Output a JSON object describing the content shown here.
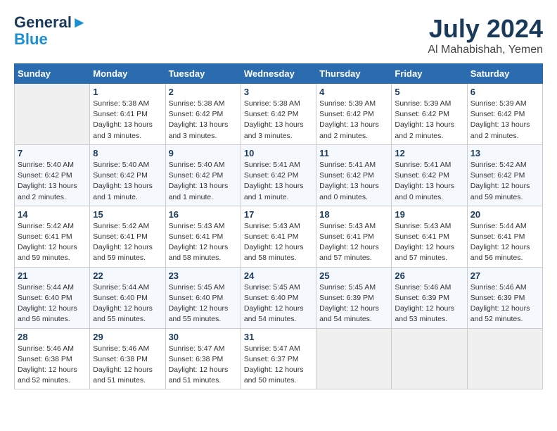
{
  "header": {
    "logo_line1": "General",
    "logo_line2": "Blue",
    "main_title": "July 2024",
    "subtitle": "Al Mahabishah, Yemen"
  },
  "weekdays": [
    "Sunday",
    "Monday",
    "Tuesday",
    "Wednesday",
    "Thursday",
    "Friday",
    "Saturday"
  ],
  "weeks": [
    [
      {
        "day": "",
        "empty": true
      },
      {
        "day": "1",
        "sunrise": "Sunrise: 5:38 AM",
        "sunset": "Sunset: 6:41 PM",
        "daylight": "Daylight: 13 hours and 3 minutes."
      },
      {
        "day": "2",
        "sunrise": "Sunrise: 5:38 AM",
        "sunset": "Sunset: 6:42 PM",
        "daylight": "Daylight: 13 hours and 3 minutes."
      },
      {
        "day": "3",
        "sunrise": "Sunrise: 5:38 AM",
        "sunset": "Sunset: 6:42 PM",
        "daylight": "Daylight: 13 hours and 3 minutes."
      },
      {
        "day": "4",
        "sunrise": "Sunrise: 5:39 AM",
        "sunset": "Sunset: 6:42 PM",
        "daylight": "Daylight: 13 hours and 2 minutes."
      },
      {
        "day": "5",
        "sunrise": "Sunrise: 5:39 AM",
        "sunset": "Sunset: 6:42 PM",
        "daylight": "Daylight: 13 hours and 2 minutes."
      },
      {
        "day": "6",
        "sunrise": "Sunrise: 5:39 AM",
        "sunset": "Sunset: 6:42 PM",
        "daylight": "Daylight: 13 hours and 2 minutes."
      }
    ],
    [
      {
        "day": "7",
        "sunrise": "Sunrise: 5:40 AM",
        "sunset": "Sunset: 6:42 PM",
        "daylight": "Daylight: 13 hours and 2 minutes."
      },
      {
        "day": "8",
        "sunrise": "Sunrise: 5:40 AM",
        "sunset": "Sunset: 6:42 PM",
        "daylight": "Daylight: 13 hours and 1 minute."
      },
      {
        "day": "9",
        "sunrise": "Sunrise: 5:40 AM",
        "sunset": "Sunset: 6:42 PM",
        "daylight": "Daylight: 13 hours and 1 minute."
      },
      {
        "day": "10",
        "sunrise": "Sunrise: 5:41 AM",
        "sunset": "Sunset: 6:42 PM",
        "daylight": "Daylight: 13 hours and 1 minute."
      },
      {
        "day": "11",
        "sunrise": "Sunrise: 5:41 AM",
        "sunset": "Sunset: 6:42 PM",
        "daylight": "Daylight: 13 hours and 0 minutes."
      },
      {
        "day": "12",
        "sunrise": "Sunrise: 5:41 AM",
        "sunset": "Sunset: 6:42 PM",
        "daylight": "Daylight: 13 hours and 0 minutes."
      },
      {
        "day": "13",
        "sunrise": "Sunrise: 5:42 AM",
        "sunset": "Sunset: 6:42 PM",
        "daylight": "Daylight: 12 hours and 59 minutes."
      }
    ],
    [
      {
        "day": "14",
        "sunrise": "Sunrise: 5:42 AM",
        "sunset": "Sunset: 6:41 PM",
        "daylight": "Daylight: 12 hours and 59 minutes."
      },
      {
        "day": "15",
        "sunrise": "Sunrise: 5:42 AM",
        "sunset": "Sunset: 6:41 PM",
        "daylight": "Daylight: 12 hours and 59 minutes."
      },
      {
        "day": "16",
        "sunrise": "Sunrise: 5:43 AM",
        "sunset": "Sunset: 6:41 PM",
        "daylight": "Daylight: 12 hours and 58 minutes."
      },
      {
        "day": "17",
        "sunrise": "Sunrise: 5:43 AM",
        "sunset": "Sunset: 6:41 PM",
        "daylight": "Daylight: 12 hours and 58 minutes."
      },
      {
        "day": "18",
        "sunrise": "Sunrise: 5:43 AM",
        "sunset": "Sunset: 6:41 PM",
        "daylight": "Daylight: 12 hours and 57 minutes."
      },
      {
        "day": "19",
        "sunrise": "Sunrise: 5:43 AM",
        "sunset": "Sunset: 6:41 PM",
        "daylight": "Daylight: 12 hours and 57 minutes."
      },
      {
        "day": "20",
        "sunrise": "Sunrise: 5:44 AM",
        "sunset": "Sunset: 6:41 PM",
        "daylight": "Daylight: 12 hours and 56 minutes."
      }
    ],
    [
      {
        "day": "21",
        "sunrise": "Sunrise: 5:44 AM",
        "sunset": "Sunset: 6:40 PM",
        "daylight": "Daylight: 12 hours and 56 minutes."
      },
      {
        "day": "22",
        "sunrise": "Sunrise: 5:44 AM",
        "sunset": "Sunset: 6:40 PM",
        "daylight": "Daylight: 12 hours and 55 minutes."
      },
      {
        "day": "23",
        "sunrise": "Sunrise: 5:45 AM",
        "sunset": "Sunset: 6:40 PM",
        "daylight": "Daylight: 12 hours and 55 minutes."
      },
      {
        "day": "24",
        "sunrise": "Sunrise: 5:45 AM",
        "sunset": "Sunset: 6:40 PM",
        "daylight": "Daylight: 12 hours and 54 minutes."
      },
      {
        "day": "25",
        "sunrise": "Sunrise: 5:45 AM",
        "sunset": "Sunset: 6:39 PM",
        "daylight": "Daylight: 12 hours and 54 minutes."
      },
      {
        "day": "26",
        "sunrise": "Sunrise: 5:46 AM",
        "sunset": "Sunset: 6:39 PM",
        "daylight": "Daylight: 12 hours and 53 minutes."
      },
      {
        "day": "27",
        "sunrise": "Sunrise: 5:46 AM",
        "sunset": "Sunset: 6:39 PM",
        "daylight": "Daylight: 12 hours and 52 minutes."
      }
    ],
    [
      {
        "day": "28",
        "sunrise": "Sunrise: 5:46 AM",
        "sunset": "Sunset: 6:38 PM",
        "daylight": "Daylight: 12 hours and 52 minutes."
      },
      {
        "day": "29",
        "sunrise": "Sunrise: 5:46 AM",
        "sunset": "Sunset: 6:38 PM",
        "daylight": "Daylight: 12 hours and 51 minutes."
      },
      {
        "day": "30",
        "sunrise": "Sunrise: 5:47 AM",
        "sunset": "Sunset: 6:38 PM",
        "daylight": "Daylight: 12 hours and 51 minutes."
      },
      {
        "day": "31",
        "sunrise": "Sunrise: 5:47 AM",
        "sunset": "Sunset: 6:37 PM",
        "daylight": "Daylight: 12 hours and 50 minutes."
      },
      {
        "day": "",
        "empty": true
      },
      {
        "day": "",
        "empty": true
      },
      {
        "day": "",
        "empty": true
      }
    ]
  ]
}
